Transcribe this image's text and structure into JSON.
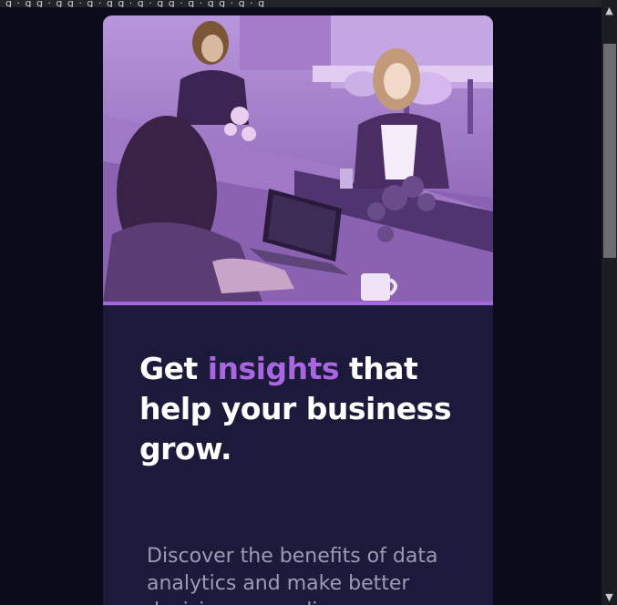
{
  "browser": {
    "top_strip_text": "g · g g · g g · g · g g · g · g g · g · g g · g · g"
  },
  "scrollbar": {
    "up_glyph": "▲",
    "down_glyph": "▼"
  },
  "card": {
    "hero_image": "office-coworkers-photo",
    "headline_prefix": "Get ",
    "headline_accent": "insights",
    "headline_suffix": " that help your business grow.",
    "body": "Discover the benefits of data analytics and make better decisions regarding"
  },
  "colors": {
    "page_bg": "#0b0c19",
    "card_bg": "#1c1a3a",
    "accent": "#a966e0",
    "headline": "#ffffff",
    "body_text": "#9d9ab3"
  }
}
